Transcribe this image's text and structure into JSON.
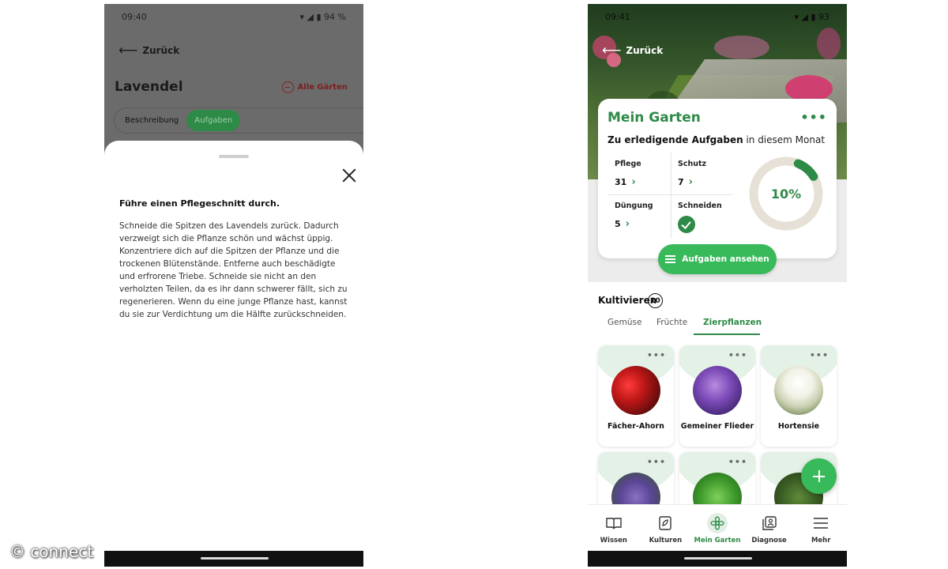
{
  "left": {
    "status": {
      "time": "09:40",
      "battery": "94 %"
    },
    "back_label": "Zurück",
    "title": "Lavendel",
    "all_gardens_label": "Alle Gärten",
    "tabs": [
      {
        "label": "Beschreibung",
        "active": false
      },
      {
        "label": "Aufgaben",
        "active": true
      }
    ],
    "sheet": {
      "title": "Führe einen Pflegeschnitt durch.",
      "body": "Schneide die Spitzen des Lavendels zurück. Dadurch verzweigt sich die Pflanze schön und wächst üppig. Konzentriere dich auf die Spitzen der Pflanze und die trockenen Blütenstände. Entferne auch beschädigte und erfrorene Triebe. Schneide sie nicht an den verholzten Teilen, da es ihr dann schwerer fällt, sich zu regenerieren. Wenn du eine junge Pflanze hast, kannst du sie zur Verdichtung um die Hälfte zurückschneiden."
    }
  },
  "right": {
    "status": {
      "time": "09:41",
      "battery": "93"
    },
    "back_label": "Zurück",
    "garden_card": {
      "title": "Mein Garten",
      "subtitle_bold": "Zu erledigende Aufgaben",
      "subtitle_rest": " in diesem Monat",
      "tasks": [
        {
          "label": "Pflege",
          "value": "31"
        },
        {
          "label": "Schutz",
          "value": "7"
        },
        {
          "label": "Düngung",
          "value": "5"
        },
        {
          "label": "Schneiden",
          "value": ""
        }
      ],
      "progress_text": "10%",
      "progress_fraction": 0.1,
      "button_label": "Aufgaben ansehen"
    },
    "cultivate": {
      "title": "Kultivieren",
      "count": "10",
      "tabs": [
        "Gemüse",
        "Früchte",
        "Zierpflanzen"
      ],
      "active_tab": "Zierpflanzen",
      "plants": [
        {
          "name": "Fächer-Ahorn"
        },
        {
          "name": "Gemeiner Flieder"
        },
        {
          "name": "Hortensie"
        },
        {
          "name": ""
        },
        {
          "name": ""
        },
        {
          "name": ""
        }
      ]
    },
    "bottom_nav": [
      {
        "label": "Wissen",
        "icon": "book-icon"
      },
      {
        "label": "Kulturen",
        "icon": "plant-doc-icon"
      },
      {
        "label": "Mein Garten",
        "icon": "flower-icon",
        "active": true
      },
      {
        "label": "Diagnose",
        "icon": "diagnosis-icon"
      },
      {
        "label": "Mehr",
        "icon": "menu-icon"
      }
    ]
  },
  "watermark": "© connect",
  "colors": {
    "accent_green": "#2e8a47",
    "button_green": "#38b95a",
    "remove_red": "#8b1e1e",
    "ring_track": "#e6e0d6"
  }
}
